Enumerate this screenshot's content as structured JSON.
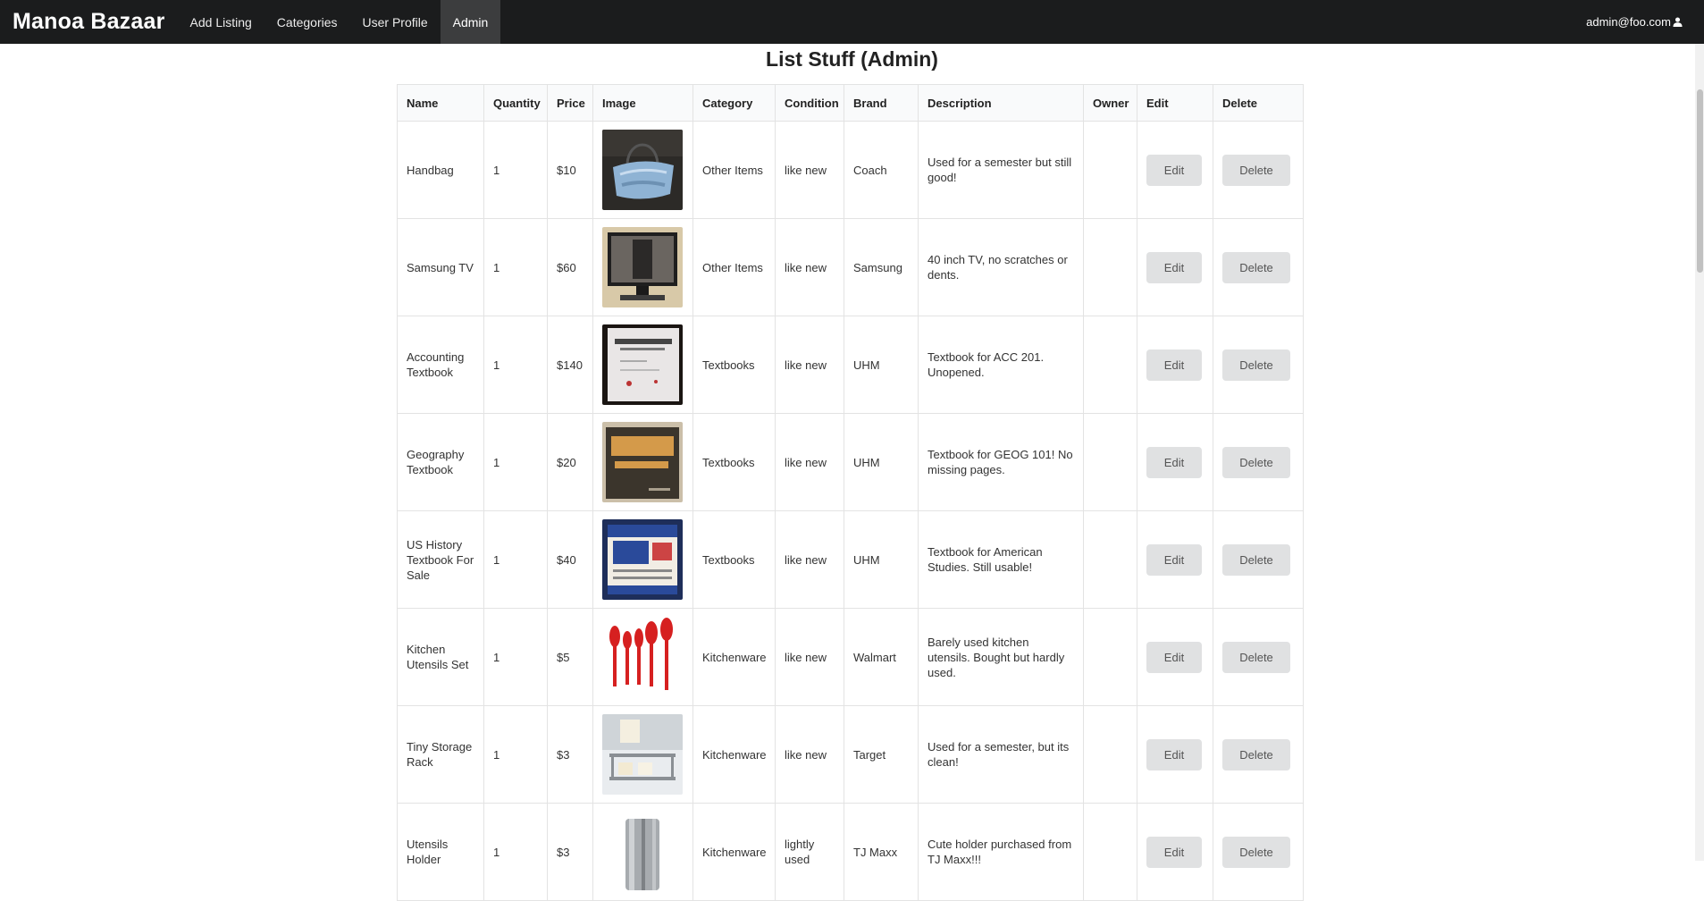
{
  "navbar": {
    "brand": "Manoa Bazaar",
    "items": [
      {
        "label": "Add Listing"
      },
      {
        "label": "Categories"
      },
      {
        "label": "User Profile"
      },
      {
        "label": "Admin"
      }
    ],
    "user_email": "admin@foo.com",
    "user_icon": "user-icon"
  },
  "page": {
    "title": "List Stuff (Admin)"
  },
  "table": {
    "columns": [
      "Name",
      "Quantity",
      "Price",
      "Image",
      "Category",
      "Condition",
      "Brand",
      "Description",
      "Owner",
      "Edit",
      "Delete"
    ],
    "edit_label": "Edit",
    "delete_label": "Delete",
    "rows": [
      {
        "name": "Handbag",
        "quantity": "1",
        "price": "$10",
        "image": "handbag-photo",
        "category": "Other Items",
        "condition": "like new",
        "brand": "Coach",
        "description": "Used for a semester but still good!",
        "owner": ""
      },
      {
        "name": "Samsung TV",
        "quantity": "1",
        "price": "$60",
        "image": "tv-photo",
        "category": "Other Items",
        "condition": "like new",
        "brand": "Samsung",
        "description": "40 inch TV, no scratches or dents.",
        "owner": ""
      },
      {
        "name": "Accounting Textbook",
        "quantity": "1",
        "price": "$140",
        "image": "accounting-book-photo",
        "category": "Textbooks",
        "condition": "like new",
        "brand": "UHM",
        "description": "Textbook for ACC 201. Unopened.",
        "owner": ""
      },
      {
        "name": "Geography Textbook",
        "quantity": "1",
        "price": "$20",
        "image": "maps-book-photo",
        "category": "Textbooks",
        "condition": "like new",
        "brand": "UHM",
        "description": "Textbook for GEOG 101! No missing pages.",
        "owner": ""
      },
      {
        "name": "US History Textbook For Sale",
        "quantity": "1",
        "price": "$40",
        "image": "us-history-book-photo",
        "category": "Textbooks",
        "condition": "like new",
        "brand": "UHM",
        "description": "Textbook for American Studies. Still usable!",
        "owner": ""
      },
      {
        "name": "Kitchen Utensils Set",
        "quantity": "1",
        "price": "$5",
        "image": "utensils-photo",
        "category": "Kitchenware",
        "condition": "like new",
        "brand": "Walmart",
        "description": "Barely used kitchen utensils. Bought but hardly used.",
        "owner": ""
      },
      {
        "name": "Tiny Storage Rack",
        "quantity": "1",
        "price": "$3",
        "image": "storage-rack-photo",
        "category": "Kitchenware",
        "condition": "like new",
        "brand": "Target",
        "description": "Used for a semester, but its clean!",
        "owner": ""
      },
      {
        "name": "Utensils Holder",
        "quantity": "1",
        "price": "$3",
        "image": "utensils-holder-photo",
        "category": "Kitchenware",
        "condition": "lightly used",
        "brand": "TJ Maxx",
        "description": "Cute holder purchased from TJ Maxx!!!",
        "owner": ""
      }
    ]
  }
}
